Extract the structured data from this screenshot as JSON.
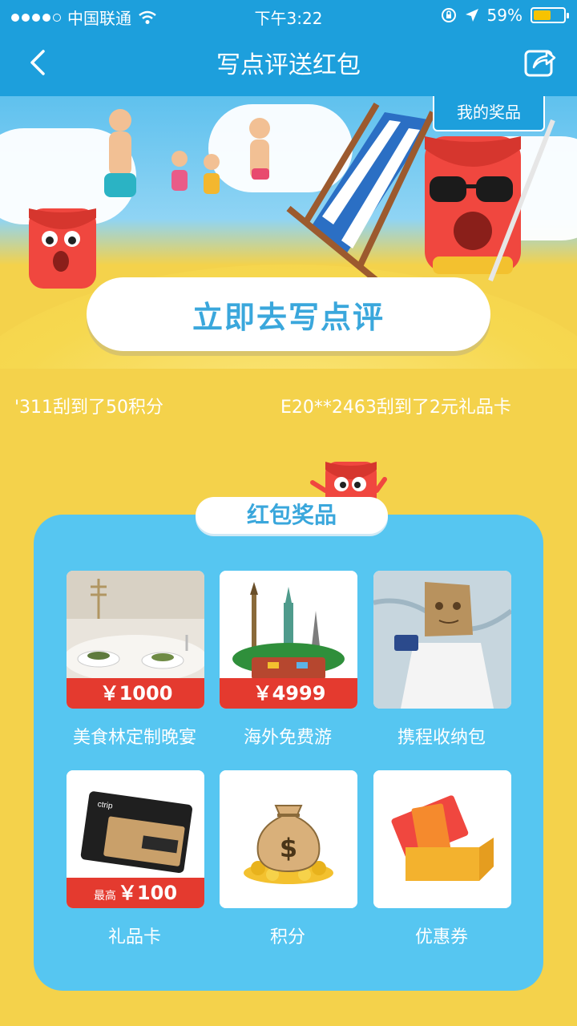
{
  "status_bar": {
    "carrier": "中国联通",
    "time": "下午3:22",
    "battery": "59%",
    "battery_level": 0.59
  },
  "nav": {
    "title": "写点评送红包"
  },
  "banner": {
    "my_prizes": "我的奖品",
    "cta": "立即去写点评"
  },
  "ticker": {
    "items": [
      "'311刮到了50积分",
      "E20**2463刮到了2元礼品卡"
    ]
  },
  "prizes": {
    "title": "红包奖品",
    "items": [
      {
        "name": "美食林定制晚宴",
        "price": "￥1000",
        "price_prefix": ""
      },
      {
        "name": "海外免费游",
        "price": "￥4999",
        "price_prefix": ""
      },
      {
        "name": "携程收纳包",
        "price": "",
        "price_prefix": ""
      },
      {
        "name": "礼品卡",
        "price": "￥100",
        "price_prefix": "最高"
      },
      {
        "name": "积分",
        "price": "",
        "price_prefix": ""
      },
      {
        "name": "优惠券",
        "price": "",
        "price_prefix": ""
      }
    ]
  },
  "colors": {
    "brand_blue": "#1d9fdc",
    "panel_blue": "#56c6f1",
    "background_yellow": "#f4d24b",
    "price_red": "#e43a2f"
  }
}
